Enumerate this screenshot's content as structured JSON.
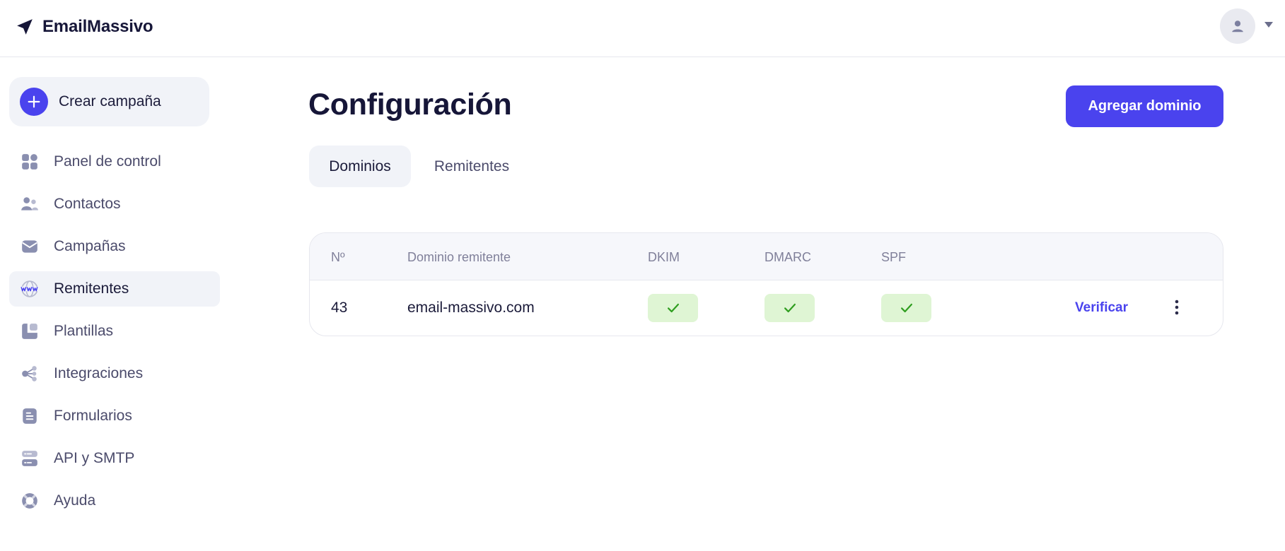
{
  "app": {
    "name": "EmailMassivo"
  },
  "sidebar": {
    "create_label": "Crear campaña",
    "items": [
      {
        "label": "Panel de control",
        "icon": "dashboard-icon"
      },
      {
        "label": "Contactos",
        "icon": "contacts-icon"
      },
      {
        "label": "Campañas",
        "icon": "campaigns-icon"
      },
      {
        "label": "Remitentes",
        "icon": "www-globe-icon",
        "active": true
      },
      {
        "label": "Plantillas",
        "icon": "templates-icon"
      },
      {
        "label": "Integraciones",
        "icon": "integrations-icon"
      },
      {
        "label": "Formularios",
        "icon": "forms-icon"
      },
      {
        "label": "API y SMTP",
        "icon": "server-icon"
      },
      {
        "label": "Ayuda",
        "icon": "lifebuoy-icon"
      }
    ]
  },
  "main": {
    "title": "Configuración",
    "add_button": "Agregar dominio",
    "tabs": [
      {
        "label": "Dominios",
        "active": true
      },
      {
        "label": "Remitentes",
        "active": false
      }
    ],
    "table": {
      "columns": [
        "Nº",
        "Dominio remitente",
        "DKIM",
        "DMARC",
        "SPF"
      ],
      "rows": [
        {
          "number": "43",
          "domain": "email-massivo.com",
          "dkim": true,
          "dmarc": true,
          "spf": true,
          "action": "Verificar"
        }
      ]
    }
  },
  "colors": {
    "accent": "#4a43ee",
    "check_bg": "#dff5d4",
    "check_mark": "#2f9e1f",
    "icon_gray": "#8a8fb0"
  }
}
